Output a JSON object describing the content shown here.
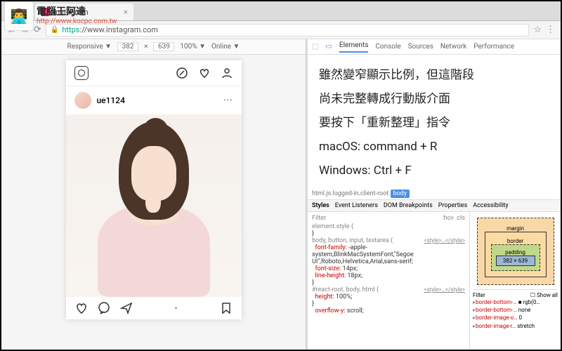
{
  "watermark": {
    "title": "電腦王阿達",
    "url": "http://www.kocpc.com.tw"
  },
  "browser": {
    "tab_title": "Instagram",
    "url_protocol": "https",
    "url_rest": "://www.instagram.com"
  },
  "device_toolbar": {
    "mode": "Responsive ▼",
    "width": "382",
    "height": "639",
    "zoom": "100% ▼",
    "network": "Online ▼"
  },
  "instagram": {
    "username": "ue1124",
    "more": "···"
  },
  "devtools": {
    "tabs": {
      "elements": "Elements",
      "console": "Console",
      "sources": "Sources",
      "network": "Network",
      "performance": "Performance"
    },
    "breadcrumb": {
      "prefix": "html.js.logged-in.client-root",
      "selected": "body"
    },
    "subtabs": {
      "styles": "Styles",
      "event": "Event Listeners",
      "dom": "DOM Breakpoints",
      "props": "Properties",
      "acc": "Accessibility"
    },
    "filter_label": "Filter",
    "hov": ":hov .cls",
    "r1": "element.style {",
    "r2": "body, button, input, textarea {",
    "link": "<style>…</style>",
    "p1": "font-family:",
    "v1": "-apple-system,BlinkMacSystemFont,\"Segoe UI\",Roboto,Helvetica,Arial,sans-serif;",
    "p2": "font-size:",
    "v2": "14px;",
    "p3": "line-height:",
    "v3": "18px;",
    "r3": "#react-root, body, html {",
    "p4": "height:",
    "v4": "100%;",
    "p5": "overflow-y:",
    "v5": "scroll;",
    "box": {
      "margin": "margin",
      "border": "border",
      "padding": "padding",
      "content": "382 × 639"
    },
    "box_filter": "Filter",
    "show_all": "Show all",
    "computed": [
      {
        "k": "border-bottom-…",
        "v": "■ rgb(0…"
      },
      {
        "k": "border-bottom-…",
        "v": "none"
      },
      {
        "k": "border-image-o…",
        "v": "0"
      },
      {
        "k": "border-image-r…",
        "v": "stretch"
      }
    ]
  },
  "annotation": {
    "line1": "雖然變窄顯示比例，但這階段",
    "line2": "尚未完整轉成行動版介面",
    "line3": "要按下「重新整理」指令",
    "line4": "macOS:  command + R",
    "line5": "Windows: Ctrl + F"
  }
}
